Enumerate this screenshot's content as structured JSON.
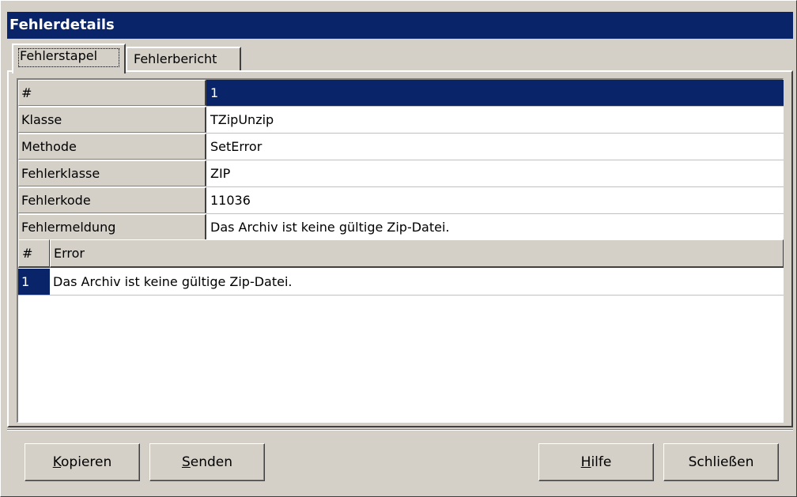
{
  "window": {
    "title": "Fehlerdetails"
  },
  "tabs": [
    {
      "label": "Fehlerstapel",
      "active": true
    },
    {
      "label": "Fehlerbericht",
      "active": false
    }
  ],
  "properties": [
    {
      "key": "#",
      "value": "1",
      "selected": true
    },
    {
      "key": "Klasse",
      "value": "TZipUnzip"
    },
    {
      "key": "Methode",
      "value": "SetError"
    },
    {
      "key": "Fehlerklasse",
      "value": "ZIP"
    },
    {
      "key": "Fehlerkode",
      "value": "11036"
    },
    {
      "key": "Fehlermeldung",
      "value": "Das Archiv ist keine gültige Zip-Datei."
    }
  ],
  "error_list": {
    "columns": [
      "#",
      "Error"
    ],
    "rows": [
      {
        "num": "1",
        "error": "Das Archiv ist keine gültige Zip-Datei."
      }
    ]
  },
  "buttons": {
    "copy": {
      "mnemonic": "K",
      "rest": "opieren"
    },
    "send": {
      "mnemonic": "S",
      "rest": "enden"
    },
    "help": {
      "mnemonic": "H",
      "rest": "ilfe"
    },
    "close": {
      "label": "Schließen"
    }
  },
  "colors": {
    "selection": "#0a246a",
    "face": "#d4d0c8"
  }
}
